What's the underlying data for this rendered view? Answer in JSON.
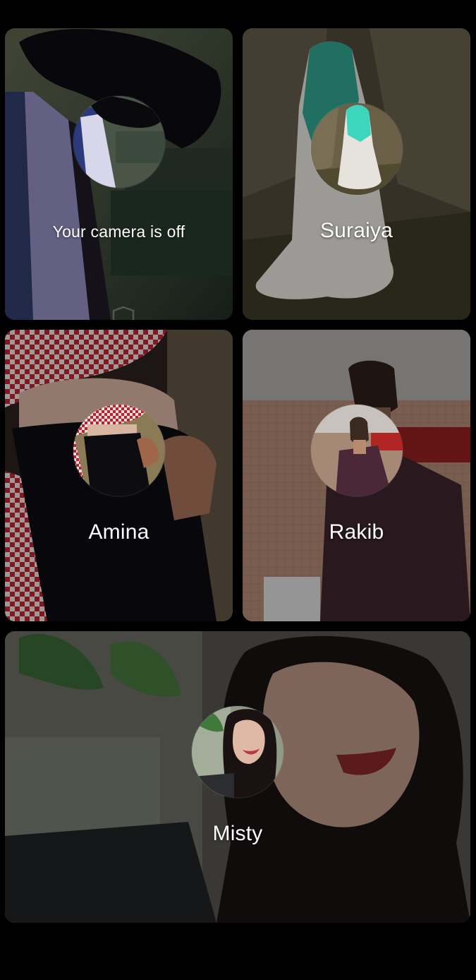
{
  "participants": [
    {
      "label": "Your camera is off"
    },
    {
      "label": "Suraiya"
    },
    {
      "label": "Amina"
    },
    {
      "label": "Rakib"
    },
    {
      "label": "Misty"
    }
  ],
  "icons": {
    "self_tile": "shield-icon"
  }
}
